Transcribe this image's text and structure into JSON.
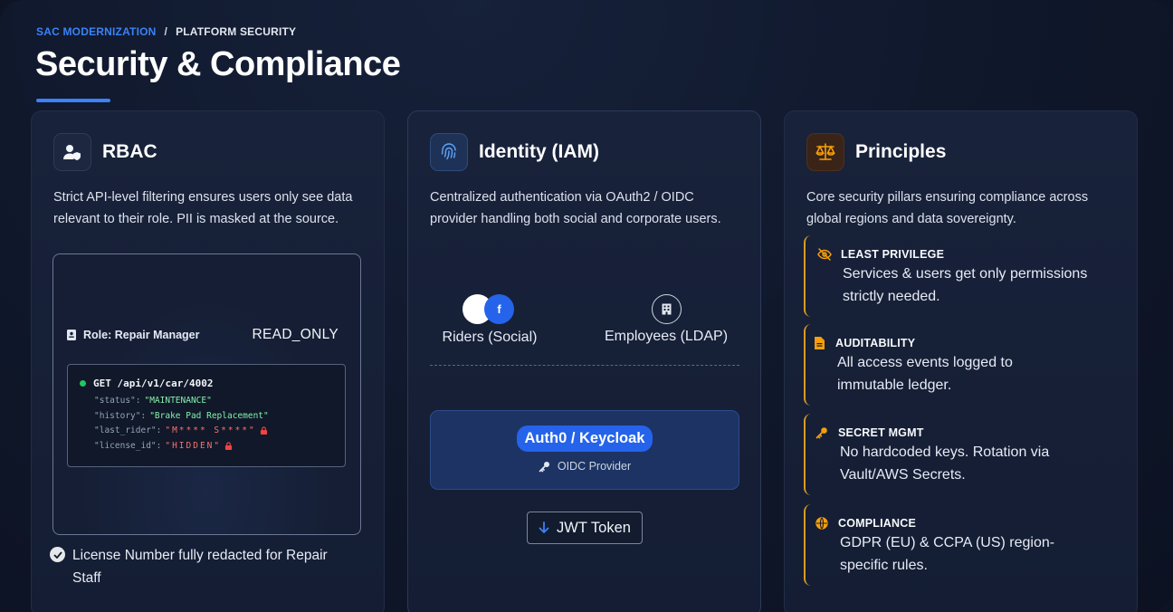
{
  "breadcrumb": {
    "section": "SAC MODERNIZATION",
    "separator": "/",
    "page": "PLATFORM SECURITY"
  },
  "page_title": "Security & Compliance",
  "colors": {
    "accent": "#3b82f6",
    "amber": "#d99a25",
    "success": "#22c55e",
    "redacted": "#f87171"
  },
  "rbac": {
    "title": "RBAC",
    "icon": "user-shield-icon",
    "description": "Strict API-level filtering ensures users only see data relevant to their role. PII is masked at the source.",
    "role_label": "Role: Repair Manager",
    "role_permission": "READ_ONLY",
    "request": "GET /api/v1/car/4002",
    "fields": [
      {
        "key": "\"status\":",
        "value": "\"MAINTENANCE\"",
        "redacted": false
      },
      {
        "key": "\"history\":",
        "value": "\"Brake Pad Replacement\"",
        "redacted": false
      },
      {
        "key": "\"last_rider\":",
        "value": "\"M**** S****\"",
        "redacted": true
      },
      {
        "key": "\"license_id\":",
        "value": "\"HIDDEN\"",
        "redacted": true
      }
    ],
    "note": "License Number fully redacted for Repair Staff"
  },
  "iam": {
    "title": "Identity (IAM)",
    "icon": "fingerprint-icon",
    "description": "Centralized authentication via OAuth2 / OIDC provider handling both social and corporate users.",
    "social_label": "Riders (Social)",
    "social_fb_glyph": "f",
    "ldap_label": "Employees (LDAP)",
    "provider_name": "Auth0 / Keycloak",
    "provider_type": "OIDC Provider",
    "token_label": "JWT Token"
  },
  "principles": {
    "title": "Principles",
    "icon": "scales-icon",
    "description": "Core security pillars ensuring compliance across global regions and data sovereignty.",
    "items": [
      {
        "title": "LEAST PRIVILEGE",
        "body": "Services & users get only permissions strictly needed.",
        "icon": "eye-slash-icon"
      },
      {
        "title": "AUDITABILITY",
        "body": "All access events logged to immutable ledger.",
        "icon": "file-icon"
      },
      {
        "title": "SECRET MGMT",
        "body": "No hardcoded keys. Rotation via Vault/AWS Secrets.",
        "icon": "key-icon"
      },
      {
        "title": "COMPLIANCE",
        "body": "GDPR (EU) & CCPA (US) region-specific rules.",
        "icon": "globe-icon"
      }
    ]
  }
}
